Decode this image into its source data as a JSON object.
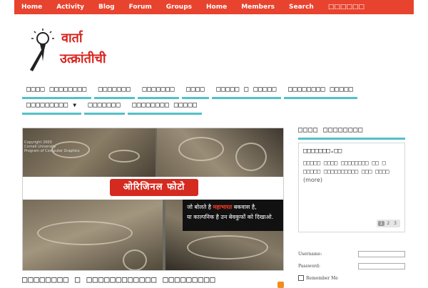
{
  "topnav": [
    "Home",
    "Activity",
    "Blog",
    "Forum",
    "Groups",
    "Home",
    "Members",
    "Search",
    "□□□□□□"
  ],
  "logo": {
    "line1": "वार्ता",
    "line2": "उत्क्रांतीची"
  },
  "mainnav": {
    "row1": [
      "□□□□ □□□□□□□□",
      "□□□□□□□",
      "□□□□□□□",
      "□□□□",
      "□□□□□ □ □□□□□",
      "□□□□□□□□ □□□□□"
    ],
    "row2": [
      "□□□□□□□□□",
      "□□□□□□□",
      "□□□□□□□□ □□□□□"
    ]
  },
  "slider": {
    "banner": "ओरिजिनल फोटो",
    "caption_pre": "जो बोलते है ",
    "caption_highlight": "महाभारत",
    "caption_post": " बकवास है,",
    "caption_line2": "या काल्पनिक है उन बेवकुफों को दिखाओ.",
    "copyright1": "Copyright 2000",
    "copyright2": "Cornell University",
    "copyright3": "Program of Computer Graphics"
  },
  "post": {
    "title": "□□□□□□□□ □ □□□□□□□□□□□□     □□□□□□□□□"
  },
  "sidebar": {
    "title": "□□□□ □□□□□□□□",
    "widget_head": "□□□□□□□.□□",
    "widget_line1": "□□□□□ □□□□ □□□□□□□□ □□ □",
    "widget_line2": "□□□□□ □□□□□□□□□□ □□□ □□□□",
    "widget_more": "(more)",
    "pages": [
      "1",
      "2",
      "3"
    ]
  },
  "login": {
    "username_label": "Username:",
    "password_label": "Password:",
    "remember_label": "Remember Me"
  }
}
